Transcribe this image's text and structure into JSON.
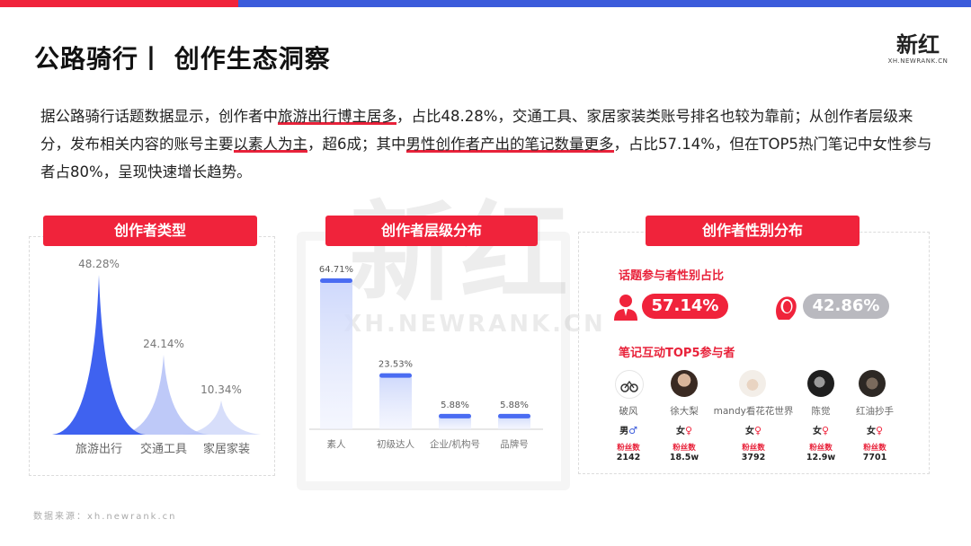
{
  "header": {
    "title": "公路骑行丨 创作生态洞察",
    "logo_main": "新红",
    "logo_sub": "XH.NEWRANK.CN"
  },
  "summary": {
    "s1": "据公路骑行话题数据显示，创作者中",
    "h1": "旅游出行博主居多",
    "s2": "，占比48.28%，交通工具、家居家装类账号排名也较为靠前；从创作者层级来分，发布相关内容的账号主要",
    "h2": "以素人为主",
    "s3": "，超6成；其中",
    "h3": "男性创作者产出的笔记数量更多",
    "s4": "，占比57.14%，但在TOP5热门笔记中女性参与者占80%，呈现快速增长趋势。"
  },
  "watermark": {
    "big": "新红",
    "sub": "XH.NEWRANK.CN"
  },
  "panels": {
    "type_title": "创作者类型",
    "level_title": "创作者层级分布",
    "gender_title": "创作者性别分布"
  },
  "chart_data": [
    {
      "type": "area",
      "title": "创作者类型",
      "categories": [
        "旅游出行",
        "交通工具",
        "家居家装"
      ],
      "values": [
        48.28,
        24.14,
        10.34
      ],
      "labels": [
        "48.28%",
        "24.14%",
        "10.34%"
      ],
      "colors": [
        "#3f62f0",
        "#b7c3f7",
        "#d3dafa"
      ]
    },
    {
      "type": "bar",
      "title": "创作者层级分布",
      "categories": [
        "素人",
        "初级达人",
        "企业/机构号",
        "品牌号"
      ],
      "values": [
        64.71,
        23.53,
        5.88,
        5.88
      ],
      "labels": [
        "64.71%",
        "23.53%",
        "5.88%",
        "5.88%"
      ],
      "color": "#4a6cf2"
    }
  ],
  "gender": {
    "share_title": "话题参与者性别占比",
    "male_pct": "57.14%",
    "female_pct": "42.86%",
    "male_color": "#f0233b",
    "female_color": "#b9b9bf",
    "top5_title": "笔记互动TOP5参与者",
    "fans_label": "粉丝数",
    "participants": [
      {
        "name": "破风",
        "sex": "男",
        "symbol": "♂",
        "fans": "2142"
      },
      {
        "name": "徐大梨",
        "sex": "女",
        "symbol": "♀",
        "fans": "18.5w"
      },
      {
        "name": "mandy看花花世界",
        "sex": "女",
        "symbol": "♀",
        "fans": "3792"
      },
      {
        "name": "陈觉",
        "sex": "女",
        "symbol": "♀",
        "fans": "12.9w"
      },
      {
        "name": "红油抄手",
        "sex": "女",
        "symbol": "♀",
        "fans": "7701"
      }
    ]
  },
  "source": "数据来源：xh.newrank.cn"
}
